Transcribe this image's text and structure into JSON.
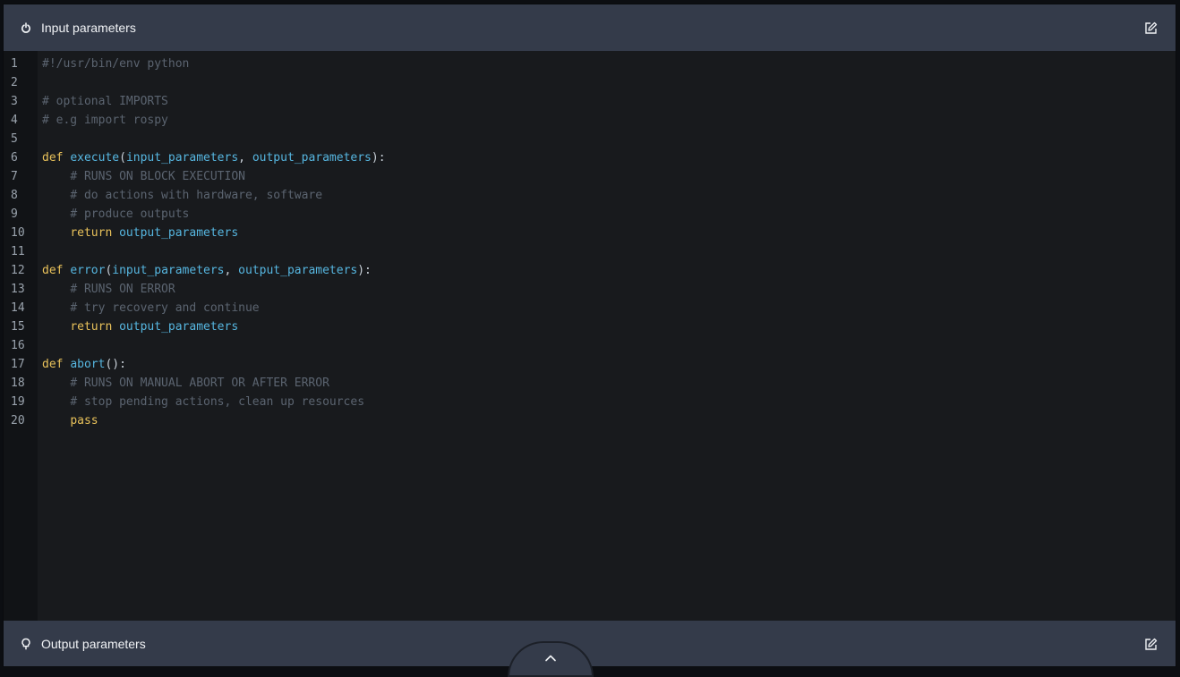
{
  "input_panel": {
    "title": "Input parameters",
    "icon": "power-icon",
    "edit_icon": "edit-icon"
  },
  "output_panel": {
    "title": "Output parameters",
    "icon": "lightbulb-icon",
    "edit_icon": "edit-icon"
  },
  "colors": {
    "header_bg": "#343b4a",
    "editor_bg": "#181a1d",
    "gutter_bg": "#111316",
    "comment": "#5b6470",
    "keyword": "#e8c15a",
    "identifier": "#56b6e0",
    "punctuation": "#c9d1d9"
  },
  "code": {
    "lines": [
      {
        "num": "1",
        "tokens": [
          {
            "t": "#!/usr/bin/env python",
            "c": "comment"
          }
        ]
      },
      {
        "num": "2",
        "tokens": []
      },
      {
        "num": "3",
        "tokens": [
          {
            "t": "# optional IMPORTS",
            "c": "comment"
          }
        ]
      },
      {
        "num": "4",
        "tokens": [
          {
            "t": "# e.g import rospy",
            "c": "comment"
          }
        ]
      },
      {
        "num": "5",
        "tokens": []
      },
      {
        "num": "6",
        "tokens": [
          {
            "t": "def",
            "c": "keyword"
          },
          {
            "t": " ",
            "c": "punct"
          },
          {
            "t": "execute",
            "c": "func"
          },
          {
            "t": "(",
            "c": "punct"
          },
          {
            "t": "input_parameters",
            "c": "param"
          },
          {
            "t": ", ",
            "c": "punct"
          },
          {
            "t": "output_parameters",
            "c": "param"
          },
          {
            "t": "):",
            "c": "punct"
          }
        ]
      },
      {
        "num": "7",
        "tokens": [
          {
            "t": "    ",
            "c": "punct"
          },
          {
            "t": "# RUNS ON BLOCK EXECUTION",
            "c": "comment"
          }
        ]
      },
      {
        "num": "8",
        "tokens": [
          {
            "t": "    ",
            "c": "punct"
          },
          {
            "t": "# do actions with hardware, software",
            "c": "comment"
          }
        ]
      },
      {
        "num": "9",
        "tokens": [
          {
            "t": "    ",
            "c": "punct"
          },
          {
            "t": "# produce outputs",
            "c": "comment"
          }
        ]
      },
      {
        "num": "10",
        "tokens": [
          {
            "t": "    ",
            "c": "punct"
          },
          {
            "t": "return",
            "c": "keyword"
          },
          {
            "t": " ",
            "c": "punct"
          },
          {
            "t": "output_parameters",
            "c": "param"
          }
        ]
      },
      {
        "num": "11",
        "tokens": []
      },
      {
        "num": "12",
        "tokens": [
          {
            "t": "def",
            "c": "keyword"
          },
          {
            "t": " ",
            "c": "punct"
          },
          {
            "t": "error",
            "c": "func"
          },
          {
            "t": "(",
            "c": "punct"
          },
          {
            "t": "input_parameters",
            "c": "param"
          },
          {
            "t": ", ",
            "c": "punct"
          },
          {
            "t": "output_parameters",
            "c": "param"
          },
          {
            "t": "):",
            "c": "punct"
          }
        ]
      },
      {
        "num": "13",
        "tokens": [
          {
            "t": "    ",
            "c": "punct"
          },
          {
            "t": "# RUNS ON ERROR",
            "c": "comment"
          }
        ]
      },
      {
        "num": "14",
        "tokens": [
          {
            "t": "    ",
            "c": "punct"
          },
          {
            "t": "# try recovery and continue",
            "c": "comment"
          }
        ]
      },
      {
        "num": "15",
        "tokens": [
          {
            "t": "    ",
            "c": "punct"
          },
          {
            "t": "return",
            "c": "keyword"
          },
          {
            "t": " ",
            "c": "punct"
          },
          {
            "t": "output_parameters",
            "c": "param"
          }
        ]
      },
      {
        "num": "16",
        "tokens": []
      },
      {
        "num": "17",
        "tokens": [
          {
            "t": "def",
            "c": "keyword"
          },
          {
            "t": " ",
            "c": "punct"
          },
          {
            "t": "abort",
            "c": "func"
          },
          {
            "t": "():",
            "c": "punct"
          }
        ]
      },
      {
        "num": "18",
        "tokens": [
          {
            "t": "    ",
            "c": "punct"
          },
          {
            "t": "# RUNS ON MANUAL ABORT OR AFTER ERROR",
            "c": "comment"
          }
        ]
      },
      {
        "num": "19",
        "tokens": [
          {
            "t": "    ",
            "c": "punct"
          },
          {
            "t": "# stop pending actions, clean up resources",
            "c": "comment"
          }
        ]
      },
      {
        "num": "20",
        "tokens": [
          {
            "t": "    ",
            "c": "punct"
          },
          {
            "t": "pass",
            "c": "keyword"
          }
        ]
      }
    ]
  },
  "collapse_toggle": {
    "icon": "chevron-up-icon"
  }
}
